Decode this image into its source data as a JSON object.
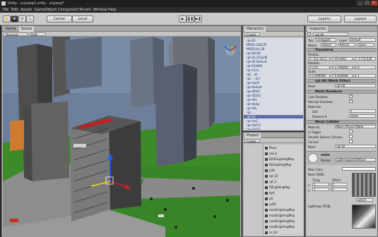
{
  "window": {
    "title": "Unity - xuyaxq1.unity - xuyaxq*",
    "min": "_",
    "max": "□",
    "close": "✕"
  },
  "menu": [
    "File",
    "Edit",
    "Assets",
    "GameObject",
    "Component",
    "Terrain",
    "Window",
    "Help"
  ],
  "toolbar": {
    "tools": [
      "✋",
      "✥",
      "⟳",
      "⤡"
    ],
    "pivot": "Center",
    "space": "Local",
    "play": "▶",
    "pause": "❚❚",
    "step": "▶❚",
    "layers": "Layers",
    "layout": "Layout"
  },
  "scene_panel": {
    "tabs": [
      "Game",
      "Scene"
    ],
    "shading": "Textured",
    "render_mode": "RGB"
  },
  "hierarchy": {
    "tab": "Hierarchy",
    "create": "Create",
    "items": [
      "rpt-40",
      "MRDS-346235",
      "MRDS-bk_58",
      "rpt-06236",
      "rpt-03_023ad8",
      "rpt-06-Default",
      "rpt-033985",
      "rpt-1111",
      "rpt-...dt",
      "rpt-...-5m",
      "rpt-hdeft",
      "rpt-Default",
      "rpt-dffdef",
      "rpt-05242",
      "rpt-d91",
      "rpt-t4afg",
      "rpt-0hk",
      "rpt-...",
      "rpt-1d",
      "rpt-mx2",
      "rpt-43473",
      "rpt-43471",
      "rpt-43472"
    ]
  },
  "project": {
    "tab": "Project",
    "create": "Create",
    "items": [
      "Mesu",
      "sssun",
      "ED45LightingMap",
      "ID2LightingMap",
      "p36",
      "rpt_01",
      "rpt_3",
      "PZLightingMap",
      "bp6",
      "p4",
      "sp09",
      "road3LightingMap",
      "road4LightingMap",
      "road5LightingMap",
      "road6LightingMap",
      "rx_04"
    ]
  },
  "inspector": {
    "tab": "Inspector",
    "object_name": "rpt-40",
    "tag_label": "Tag",
    "tag_value": "Untagged",
    "layer_label": "Layer",
    "layer_value": "Default",
    "prefab_label": "Model",
    "prefab_buttons": [
      "Select",
      "Revert",
      "Open"
    ],
    "transform": {
      "title": "Transform",
      "position_label": "Position",
      "position": [
        "X -411.9213",
        "Y 59.4462",
        "Z -1776.026"
      ],
      "rotation_label": "Rotation",
      "rotation": [
        "X 270",
        "Y 1.785854",
        "Z 0"
      ],
      "scale_label": "Scale",
      "scale": [
        "X 0.999999",
        "Y 0.999999",
        "Z 1"
      ]
    },
    "mesh_filter": {
      "title": "rpt-40 (Mesh Filter)",
      "mesh_label": "Mesh",
      "mesh_value": "rpt-40"
    },
    "mesh_renderer": {
      "title": "Mesh Renderer",
      "cast_shadows": "Cast Shadows",
      "receive_shadows": "Receive Shadows",
      "materials": "Materials",
      "size_label": "Size",
      "size_value": "1",
      "element_label": "Element 0",
      "element_value": "white"
    },
    "mesh_collider": {
      "title": "Mesh Collider",
      "material_label": "Material",
      "material_value": "None (Physic Mater",
      "is_trigger": "Is Trigger",
      "smooth": "Smooth Sphere Collision",
      "convex": "Convex",
      "mesh_label": "Mesh",
      "mesh_value": "rpt-40"
    },
    "material": {
      "name": "white",
      "shader_label": "Shader",
      "shader_value": "Lightmapped/Diffuse",
      "main_color": "Main Color",
      "base_label": "Base (RGB)",
      "tiling": "Tiling",
      "offset": "Offset",
      "x_label": "x",
      "x_tiling": "1",
      "x_offset": "0",
      "y_label": "y",
      "y_tiling": "1",
      "y_offset": "0",
      "select": "Select",
      "lightmap_label": "Lightmap (RGB)"
    }
  },
  "colors": {
    "sky": "#6d7f9a",
    "grass": "#3d8a2a",
    "road": "#8a8a8a",
    "selection": "#5a6fa8"
  }
}
